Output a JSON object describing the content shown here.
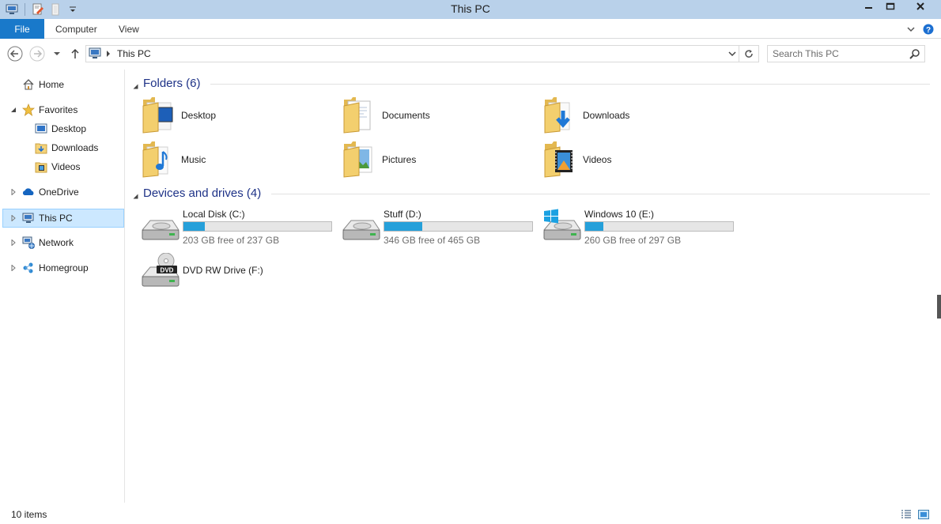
{
  "window": {
    "title": "This PC"
  },
  "ribbon": {
    "file_label": "File",
    "tabs": [
      "Computer",
      "View"
    ]
  },
  "address": {
    "location": "This PC"
  },
  "search": {
    "placeholder": "Search This PC"
  },
  "nav_pane": {
    "home": "Home",
    "favorites": "Favorites",
    "fav_items": [
      "Desktop",
      "Downloads",
      "Videos"
    ],
    "onedrive": "OneDrive",
    "this_pc": "This PC",
    "network": "Network",
    "homegroup": "Homegroup"
  },
  "folders": {
    "header": "Folders (6)",
    "items": [
      {
        "name": "Desktop",
        "icon": "desktop-folder-icon"
      },
      {
        "name": "Documents",
        "icon": "documents-folder-icon"
      },
      {
        "name": "Downloads",
        "icon": "downloads-folder-icon"
      },
      {
        "name": "Music",
        "icon": "music-folder-icon"
      },
      {
        "name": "Pictures",
        "icon": "pictures-folder-icon"
      },
      {
        "name": "Videos",
        "icon": "videos-folder-icon"
      }
    ]
  },
  "drives": {
    "header": "Devices and drives (4)",
    "items": [
      {
        "name": "Local Disk (C:)",
        "free_text": "203 GB free of 237 GB",
        "used_fraction": 0.143
      },
      {
        "name": "Stuff (D:)",
        "free_text": "346 GB free of 465 GB",
        "used_fraction": 0.256
      },
      {
        "name": "Windows 10 (E:)",
        "free_text": "260 GB free of 297 GB",
        "used_fraction": 0.125
      },
      {
        "name": "DVD RW Drive (F:)"
      }
    ]
  },
  "status": {
    "item_count": "10 items"
  },
  "colors": {
    "titlebar": "#b9d1ea",
    "file_tab": "#1979ca",
    "accent_text": "#1e3287",
    "usage_bar": "#26a0da",
    "selection": "#cce8ff"
  }
}
